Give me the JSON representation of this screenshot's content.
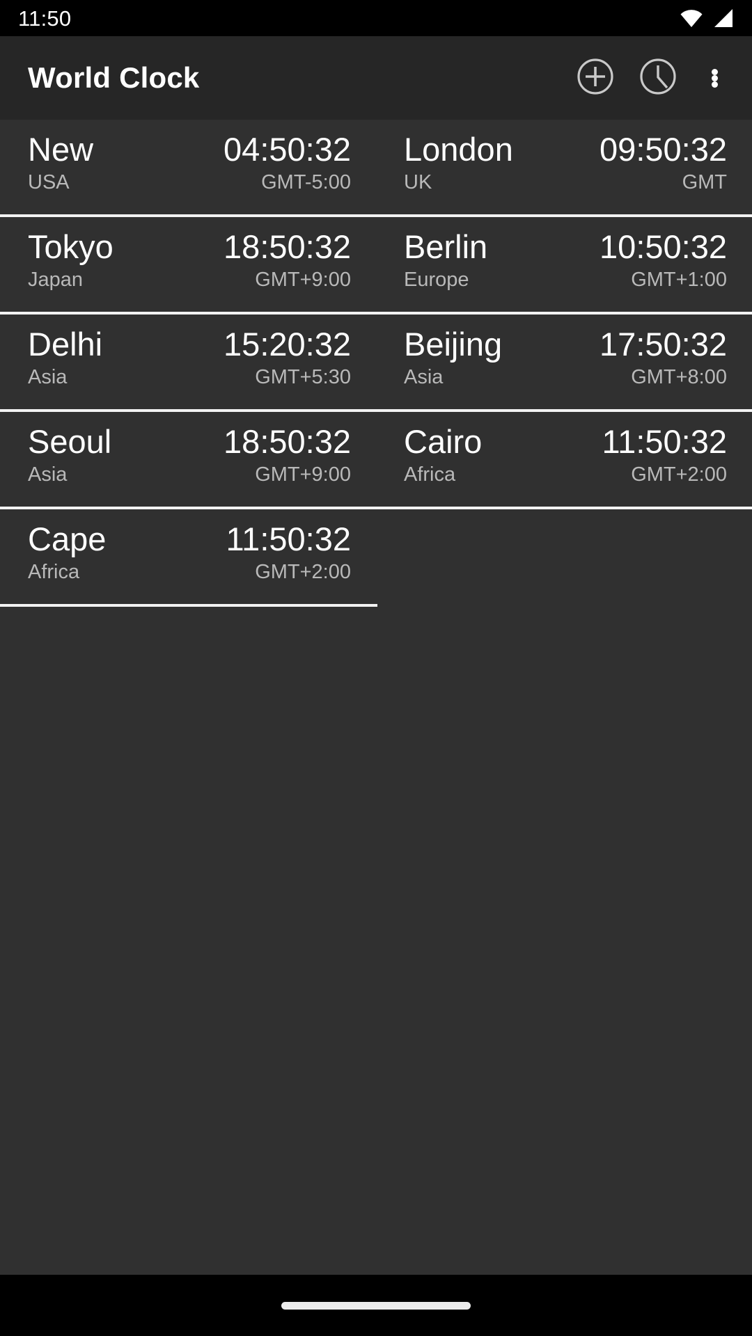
{
  "status_bar": {
    "time": "11:50",
    "icons": [
      {
        "name": "wifi-icon"
      },
      {
        "name": "cell-signal-icon"
      }
    ]
  },
  "app_bar": {
    "title": "World Clock",
    "actions": [
      {
        "name": "add-clock-button",
        "icon": "plus-circle-icon",
        "label": "Add"
      },
      {
        "name": "timer-button",
        "icon": "clock-circle-icon",
        "label": "Clock"
      },
      {
        "name": "overflow-menu-button",
        "icon": "more-vertical-icon",
        "label": "More options"
      }
    ]
  },
  "clock_list": {
    "columns": [
      "city",
      "time",
      "region",
      "offset"
    ],
    "entries": [
      {
        "city": "New",
        "time": "04:50:32",
        "region": "USA",
        "offset": "GMT-5:00"
      },
      {
        "city": "London",
        "time": "09:50:32",
        "region": "UK",
        "offset": "GMT"
      },
      {
        "city": "Tokyo",
        "time": "18:50:32",
        "region": "Japan",
        "offset": "GMT+9:00"
      },
      {
        "city": "Berlin",
        "time": "10:50:32",
        "region": "Europe",
        "offset": "GMT+1:00"
      },
      {
        "city": "Delhi",
        "time": "15:20:32",
        "region": "Asia",
        "offset": "GMT+5:30"
      },
      {
        "city": "Beijing",
        "time": "17:50:32",
        "region": "Asia",
        "offset": "GMT+8:00"
      },
      {
        "city": "Seoul",
        "time": "18:50:32",
        "region": "Asia",
        "offset": "GMT+9:00"
      },
      {
        "city": "Cairo",
        "time": "11:50:32",
        "region": "Africa",
        "offset": "GMT+2:00"
      },
      {
        "city": "Cape",
        "time": "11:50:32",
        "region": "Africa",
        "offset": "GMT+2:00"
      }
    ]
  },
  "nav_bar": {
    "handle": "home-gesture-pill"
  },
  "colors": {
    "status_bar_bg": "#000000",
    "app_bar_bg": "#262626",
    "list_bg": "#303030",
    "divider": "#f2f2f2",
    "primary_text": "#ffffff",
    "secondary_text": "#b9b9b9",
    "icon_stroke": "#c9c9c9"
  }
}
